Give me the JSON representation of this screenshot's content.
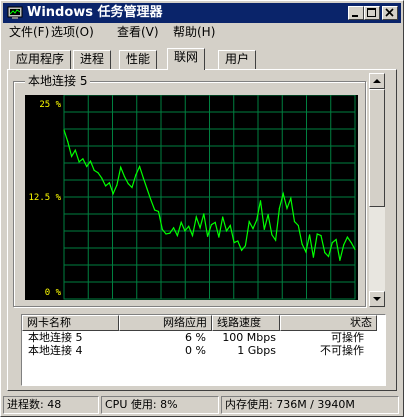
{
  "window": {
    "title": "Windows 任务管理器"
  },
  "menu": [
    "文件(F)",
    "选项(O)",
    "查看(V)",
    "帮助(H)"
  ],
  "tabs": [
    "应用程序",
    "进程",
    "性能",
    "联网",
    "用户"
  ],
  "active_tab": "联网",
  "graph": {
    "label": "本地连接 5",
    "y_ticks": [
      "25 %",
      "12.5 %",
      "0 %"
    ],
    "colors": {
      "line": "#00ff00",
      "grid": "#008040",
      "tick": "#ffff00",
      "background": "#000000"
    }
  },
  "chart_data": {
    "type": "line",
    "title": "本地连接 5",
    "ylim": [
      0,
      25
    ],
    "grid": true,
    "series": [
      {
        "values": [
          21.0,
          19.5,
          17.6,
          18.4,
          16.9,
          17.3,
          16.3,
          17.0,
          15.8,
          15.5,
          14.8,
          13.8,
          14.2,
          12.8,
          13.9,
          16.2,
          15.0,
          14.1,
          13.6,
          15.2,
          16.3,
          14.8,
          13.4,
          12.0,
          10.7,
          10.5,
          8.2,
          7.6,
          7.7,
          8.4,
          7.4,
          9.1,
          8.0,
          8.6,
          7.4,
          9.8,
          8.4,
          10.2,
          7.3,
          8.8,
          9.1,
          7.2,
          9.8,
          8.0,
          8.7,
          6.5,
          6.7,
          5.5,
          6.1,
          9.2,
          8.3,
          9.4,
          11.9,
          8.2,
          10.1,
          7.5,
          6.8,
          10.9,
          12.8,
          10.9,
          12.2,
          9.2,
          8.7,
          6.3,
          5.3,
          7.5,
          4.6,
          7.6,
          7.4,
          5.2,
          4.7,
          6.5,
          6.9,
          4.2,
          6.2,
          7.2,
          6.5,
          5.6
        ]
      }
    ]
  },
  "list": {
    "columns": [
      "网卡名称",
      "网络应用",
      "线路速度",
      "状态"
    ],
    "rows": [
      {
        "name": "本地连接 5",
        "util": "6 %",
        "speed": "100 Mbps",
        "status": "可操作"
      },
      {
        "name": "本地连接 4",
        "util": "0 %",
        "speed": "1 Gbps",
        "status": "不可操作"
      }
    ]
  },
  "status": {
    "processes": "进程数: 48",
    "cpu": "CPU 使用: 8%",
    "memory": "内存使用: 736M / 3940M"
  }
}
